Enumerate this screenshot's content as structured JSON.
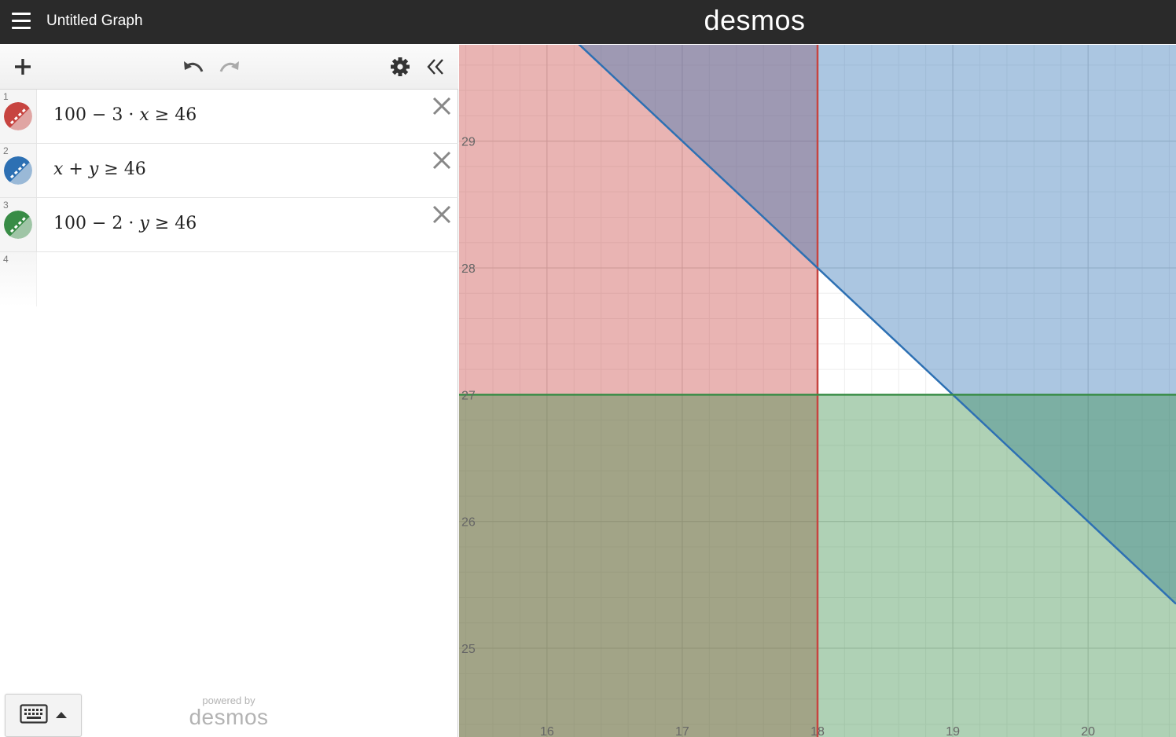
{
  "app": {
    "title": "Untitled Graph",
    "logo": "desmos",
    "menu_icon": "hamburger-icon"
  },
  "toolbar": {
    "add_icon": "plus-icon",
    "undo_icon": "undo-icon",
    "redo_icon": "redo-icon",
    "settings_icon": "gear-icon",
    "collapse_icon": "double-chevron-left-icon"
  },
  "expressions": [
    {
      "number": "1",
      "color": "#c74440",
      "parts": [
        "100 − 3 · ",
        "x",
        " ≥ 46"
      ]
    },
    {
      "number": "2",
      "color": "#2d70b3",
      "parts": [
        "",
        "x",
        " + ",
        "y",
        " ≥ 46"
      ]
    },
    {
      "number": "3",
      "color": "#388c46",
      "parts": [
        "100 − 2 · ",
        "y",
        " ≥ 46"
      ]
    },
    {
      "number": "4"
    }
  ],
  "footer": {
    "powered_by": "powered by",
    "brand": "desmos",
    "keyboard_icon": "keyboard-icon"
  },
  "graph": {
    "x_range": [
      15.35,
      20.65
    ],
    "y_range": [
      24.3,
      29.76
    ],
    "x_ticks": [
      "16",
      "17",
      "18",
      "19",
      "20"
    ],
    "y_ticks": [
      "25",
      "26",
      "27",
      "28",
      "29"
    ],
    "grid": true,
    "regions": [
      {
        "inequality": "100 - 3x >= 46",
        "boundary": "x = 18",
        "side": "x <= 18",
        "color": "#c74440"
      },
      {
        "inequality": "x + y >= 46",
        "boundary": "y = 46 - x",
        "side": "above",
        "color": "#2d70b3"
      },
      {
        "inequality": "100 - 2y >= 46",
        "boundary": "y = 27",
        "side": "y <= 27",
        "color": "#388c46"
      }
    ]
  }
}
